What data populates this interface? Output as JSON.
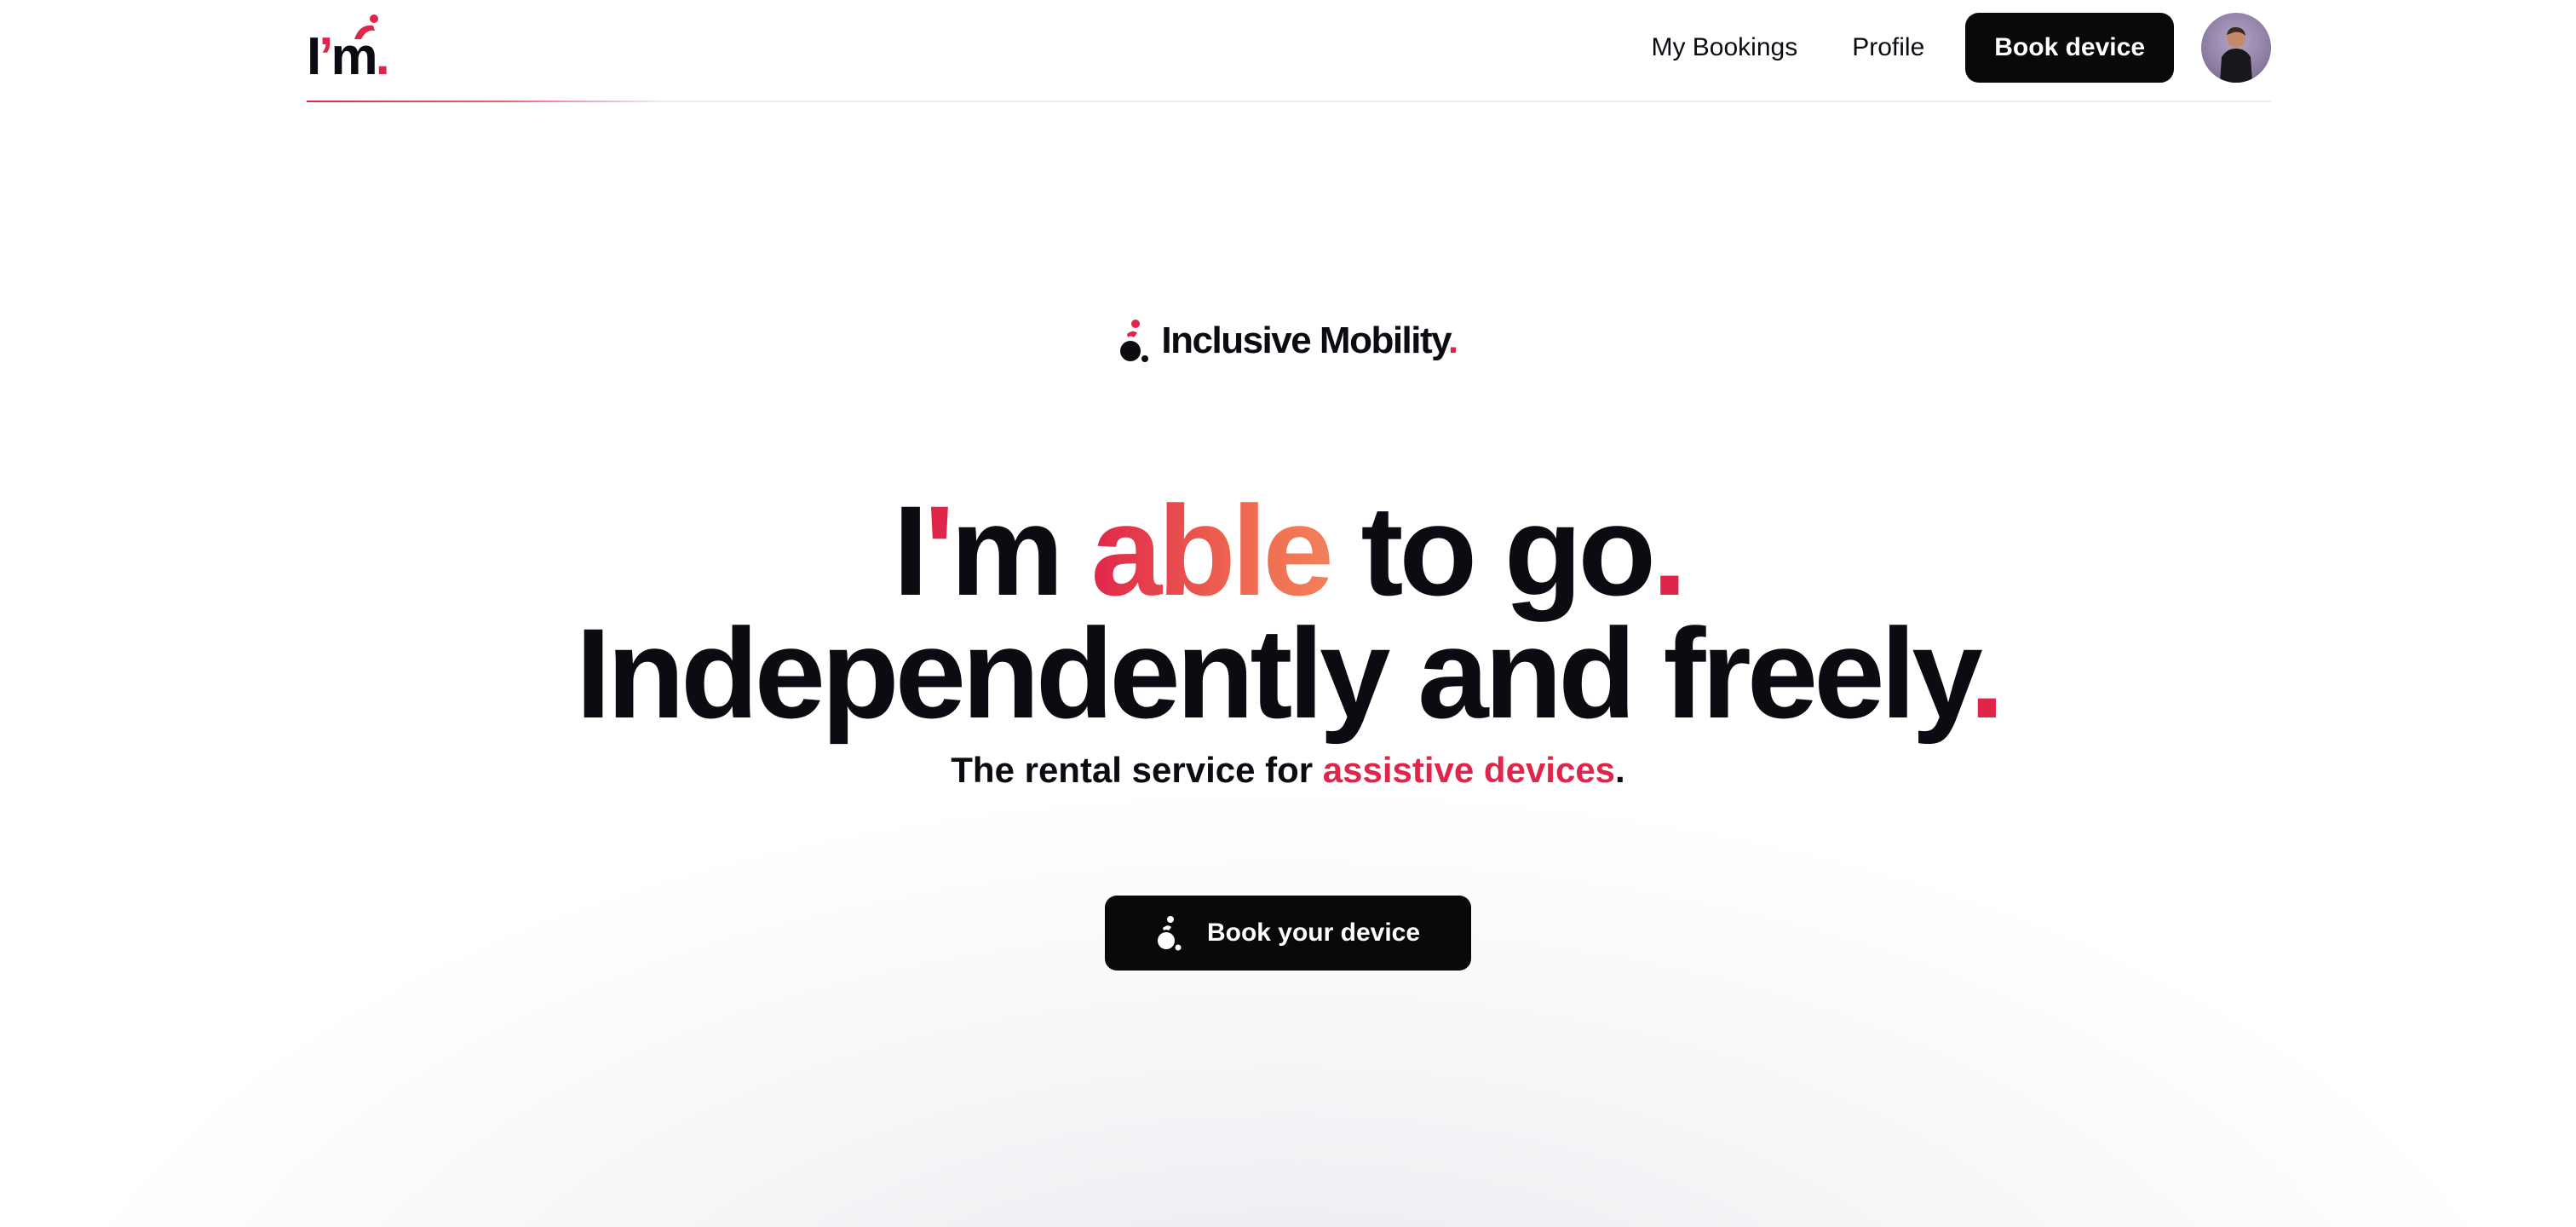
{
  "header": {
    "logo": {
      "main": "I",
      "apostrophe": "’",
      "rest": "m",
      "dot": "."
    },
    "nav": {
      "my_bookings": "My Bookings",
      "profile": "Profile",
      "book_device": "Book device"
    },
    "avatar_icon": "user-avatar-icon"
  },
  "hero": {
    "brand": {
      "name": "Inclusive Mobility",
      "dot": ".",
      "icon": "wheelchair-user-icon"
    },
    "headline_line1": {
      "part1": "I",
      "apostrophe": "'",
      "part2": "m ",
      "highlight": "able",
      "part3": " to go",
      "dot": "."
    },
    "headline_line2": {
      "text": "Independently and freely",
      "dot": "."
    },
    "tagline": {
      "prefix": "The rental service for ",
      "highlight": "assistive devices",
      "suffix": "."
    },
    "cta": {
      "label": "Book your device",
      "icon": "wheelchair-user-icon"
    }
  },
  "colors": {
    "accent": "#e0254b",
    "gradient_end": "#f3805a",
    "text": "#0b0b12",
    "button_bg": "#09090b",
    "button_text": "#ffffff"
  }
}
